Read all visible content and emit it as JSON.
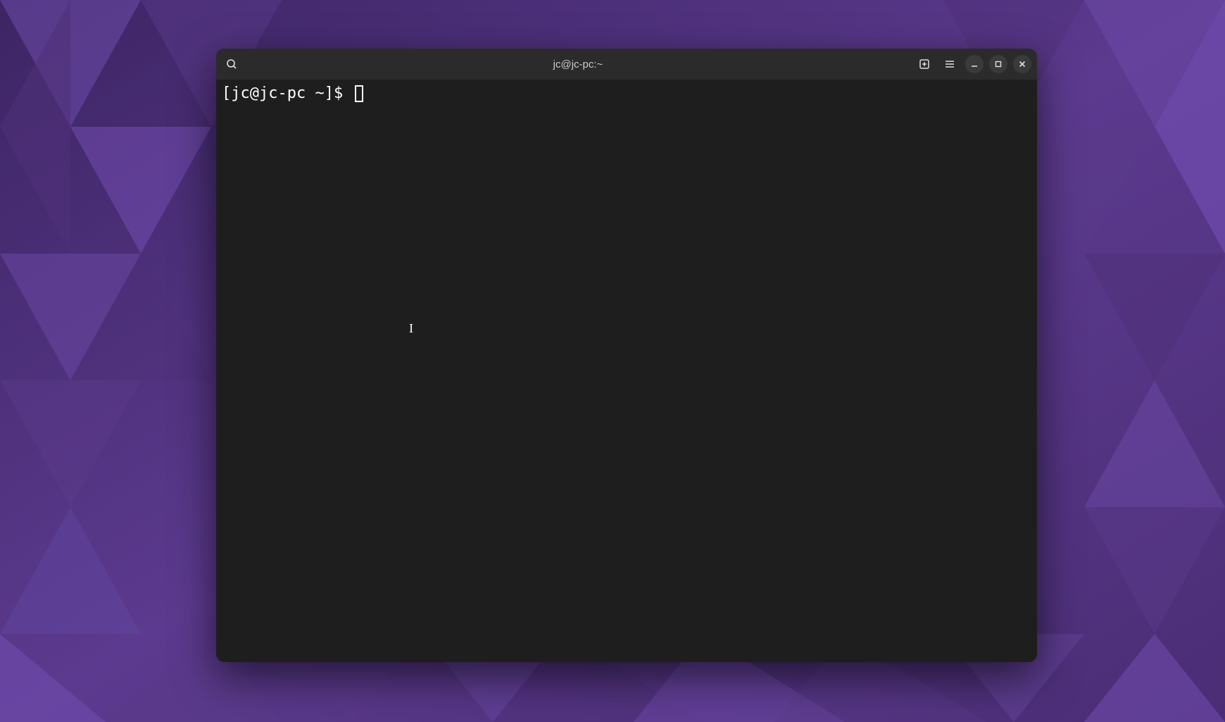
{
  "window": {
    "title": "jc@jc-pc:~"
  },
  "terminal": {
    "prompt": "[jc@jc-pc ~]$ "
  },
  "icons": {
    "search": "search-icon",
    "new_tab": "new-tab-icon",
    "menu": "hamburger-icon",
    "minimize": "minimize-icon",
    "maximize": "maximize-icon",
    "close": "close-icon"
  }
}
